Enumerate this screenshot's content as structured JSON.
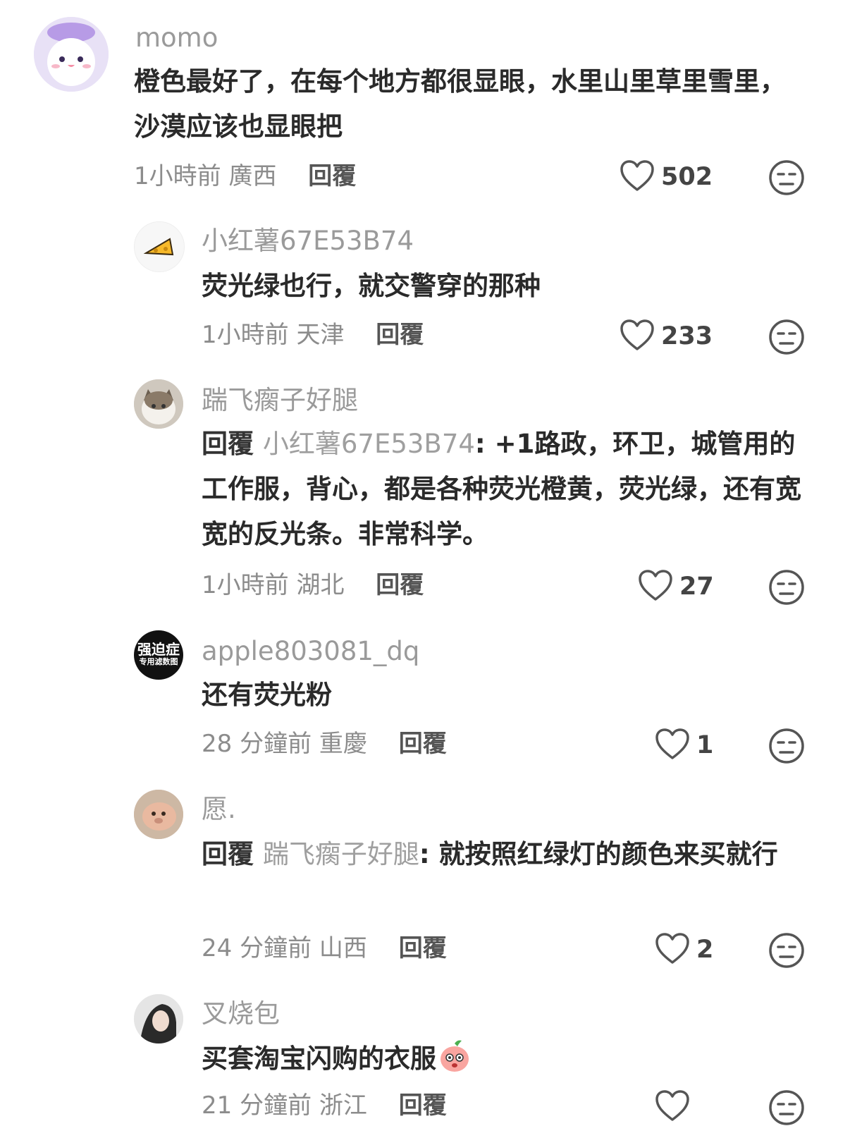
{
  "comments": [
    {
      "username": "momo",
      "text": "橙色最好了，在每个地方都很显眼，水里山里草里雪里，沙漠应该也显眼把",
      "time": "1小時前",
      "location": "廣西",
      "reply_label": "回覆",
      "likes": "502"
    },
    {
      "username": "小红薯67E53B74",
      "text": "荧光绿也行，就交警穿的那种",
      "time": "1小時前",
      "location": "天津",
      "reply_label": "回覆",
      "likes": "233"
    },
    {
      "username": "踹飞瘸子好腿",
      "reply_prefix": "回覆",
      "reply_target": "小红薯67E53B74",
      "text": ": +1路政，环卫，城管用的工作服，背心，都是各种荧光橙黄，荧光绿，还有宽宽的反光条。非常科学。",
      "time": "1小時前",
      "location": "湖北",
      "reply_label": "回覆",
      "likes": "27"
    },
    {
      "username": "apple803081_dq",
      "text": "还有荧光粉",
      "time": "28 分鐘前",
      "location": "重慶",
      "reply_label": "回覆",
      "likes": "1",
      "avatar_text_1": "强迫症",
      "avatar_text_2": "专用滤数图"
    },
    {
      "username": "愿.",
      "reply_prefix": "回覆",
      "reply_target": "踹飞瘸子好腿",
      "text": ": 就按照红绿灯的颜色来买就行",
      "time": "24 分鐘前",
      "location": "山西",
      "reply_label": "回覆",
      "likes": "2"
    },
    {
      "username": "叉烧包",
      "text": "买套淘宝闪购的衣服",
      "time": "21 分鐘前",
      "location": "浙江",
      "reply_label": "回覆"
    }
  ]
}
